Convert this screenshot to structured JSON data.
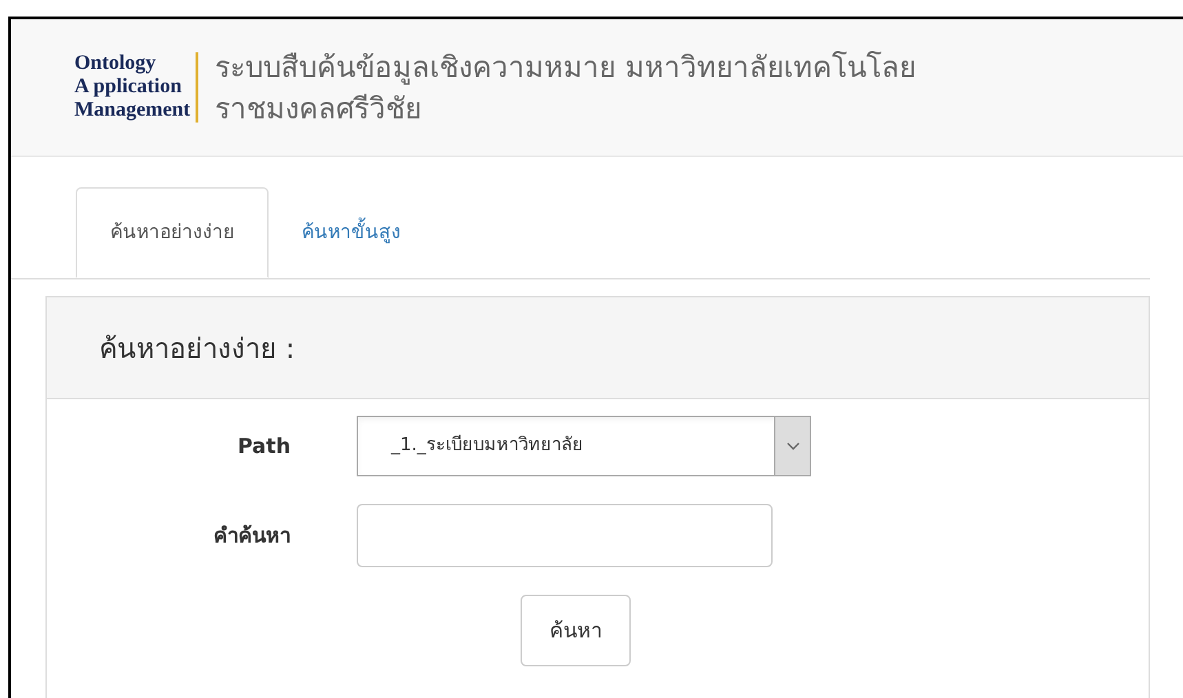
{
  "header": {
    "logo": [
      "Ontology",
      "A pplication",
      "Management"
    ],
    "title_lines": [
      "ระบบสืบค้นข้อมูลเชิงความหมาย มหาวิทยาลัยเทคโนโลย",
      "ราชมงคลศรีวิชัย"
    ]
  },
  "tabs": [
    {
      "label": "ค้นหาอย่างง่าย",
      "selected": true
    },
    {
      "label": "ค้นหาขั้นสูง",
      "selected": false
    }
  ],
  "panel": {
    "heading": "ค้นหาอย่างง่าย :",
    "fields": [
      {
        "kind": "select",
        "label": "Path",
        "value": "_1._ระเบียบมหาวิทยาลัย"
      },
      {
        "kind": "text",
        "label": "คำค้นหา"
      }
    ],
    "button": "ค้นหา"
  }
}
